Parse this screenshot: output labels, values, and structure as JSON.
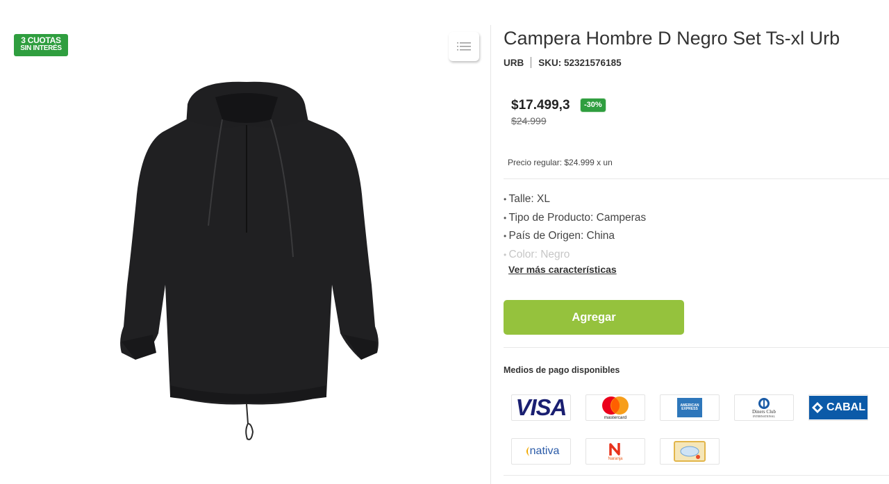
{
  "badge": {
    "line1": "3 CUOTAS",
    "line2": "SIN INTERÉS"
  },
  "gallery": {
    "toggle_icon": "list-icon",
    "image_alt": "Campera negra con capucha"
  },
  "product": {
    "title": "Campera Hombre D Negro Set Ts-xl Urb",
    "brand": "URB",
    "sku": "SKU: 52321576185",
    "price": "$17.499,3",
    "discount": "-30%",
    "old_price": "$24.999",
    "regular_price": "Precio regular: $24.999 x un"
  },
  "features": [
    "Talle: XL",
    "Tipo de Producto: Camperas",
    "País de Origen: China",
    "Color: Negro"
  ],
  "see_more": "Ver más características",
  "add_button": "Agregar",
  "payments": {
    "title": "Medios de pago disponibles",
    "visa": "VISA",
    "mastercard": "mastercard",
    "amex_line1": "AMERICAN",
    "amex_line2": "EXPRESS",
    "diners_line1": "Diners Club",
    "diners_line2": "INTERNATIONAL",
    "cabal": "CABAL",
    "nativa": "nativa",
    "naranja": "Naranja"
  },
  "colors": {
    "accent_green": "#2f9e3f",
    "button": "#95c23d",
    "visa": "#1a1f71",
    "cabal": "#0b5aa8"
  }
}
